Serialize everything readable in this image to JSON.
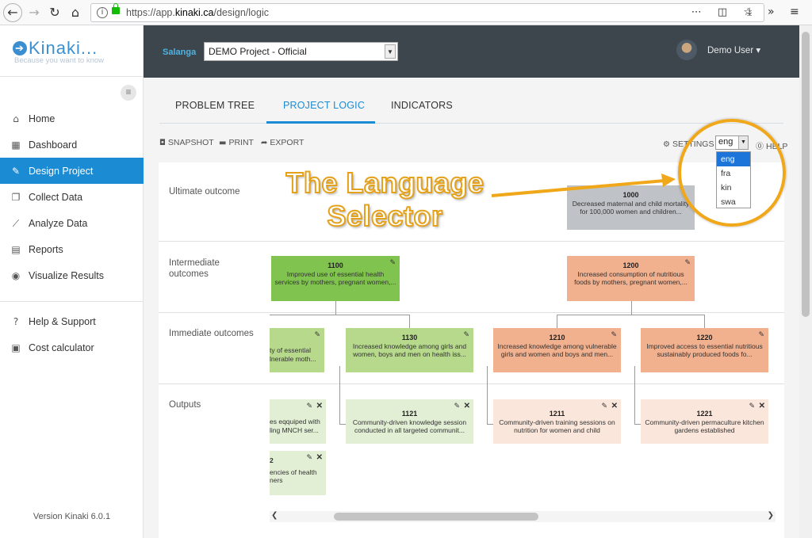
{
  "browser": {
    "url_prefix": "https://app.",
    "url_domain": "kinaki.ca",
    "url_path": "/design/logic"
  },
  "logo": {
    "name": "Kinaki...",
    "tagline": "Because you want to know"
  },
  "sidebar": {
    "items": [
      {
        "label": "Home",
        "icon": "home-icon",
        "glyph": "⌂"
      },
      {
        "label": "Dashboard",
        "icon": "dashboard-icon",
        "glyph": "▦"
      },
      {
        "label": "Design Project",
        "icon": "pencil-icon",
        "glyph": "✎"
      },
      {
        "label": "Collect Data",
        "icon": "copy-icon",
        "glyph": "❐"
      },
      {
        "label": "Analyze Data",
        "icon": "line-chart-icon",
        "glyph": "⟋"
      },
      {
        "label": "Reports",
        "icon": "file-icon",
        "glyph": "▤"
      },
      {
        "label": "Visualize Results",
        "icon": "target-icon",
        "glyph": "◉"
      },
      {
        "label": "Help & Support",
        "icon": "question-icon",
        "glyph": "?"
      },
      {
        "label": "Cost calculator",
        "icon": "calculator-icon",
        "glyph": "▣"
      }
    ],
    "version": "Version Kinaki 6.0.1"
  },
  "topbar": {
    "org": "Salanga",
    "project": "DEMO Project - Official",
    "user": "Demo User ▾"
  },
  "tabs": [
    "PROBLEM TREE",
    "PROJECT LOGIC",
    "INDICATORS"
  ],
  "toolbar": {
    "snapshot": "SNAPSHOT",
    "print": "PRINT",
    "export": "EXPORT",
    "settings": "SETTINGS",
    "help": "HELP"
  },
  "language": {
    "selected": "eng",
    "options": [
      "eng",
      "fra",
      "kin",
      "swa"
    ]
  },
  "rows": {
    "ultimate": "Ultimate outcome",
    "intermediate": "Intermediate outcomes",
    "immediate": "Immediate outcomes",
    "outputs": "Outputs"
  },
  "cards": {
    "c1000": {
      "id": "1000",
      "text": "Decreased maternal and child mortality for 100,000 women and children..."
    },
    "c1100": {
      "id": "1100",
      "text": "Improved use of essential health services by mothers, pregnant women,..."
    },
    "c1200": {
      "id": "1200",
      "text": "Increased consumption of nutritious foods by mothers, pregnant women,..."
    },
    "c1120": {
      "text": "ty of essential lnerable moth..."
    },
    "c1130": {
      "id": "1130",
      "text": "Increased knowledge among girls and women, boys and men on health iss..."
    },
    "c1210": {
      "id": "1210",
      "text": "Increased knowledge among vulnerable girls and women and boys and men..."
    },
    "c1220": {
      "id": "1220",
      "text": "Improved access to essential nutritious sustainably produced foods fo..."
    },
    "o1": {
      "text": "es eqquiped with ling MNCH ser..."
    },
    "c1121": {
      "id": "1121",
      "text": "Community-driven knowledge session conducted in all targeted communit..."
    },
    "c1211": {
      "id": "1211",
      "text": "Community-driven training sessions on nutrition for women and child"
    },
    "c1221": {
      "id": "1221",
      "text": "Community-driven permaculture kitchen gardens established"
    },
    "o2": {
      "id": "2",
      "text": "encies of health ners"
    }
  },
  "annotation": {
    "line1": "The Language",
    "line2": "Selector"
  },
  "colors": {
    "accent": "#1b8bd4",
    "topbar": "#3d464d",
    "annotation": "#f0a81a"
  }
}
